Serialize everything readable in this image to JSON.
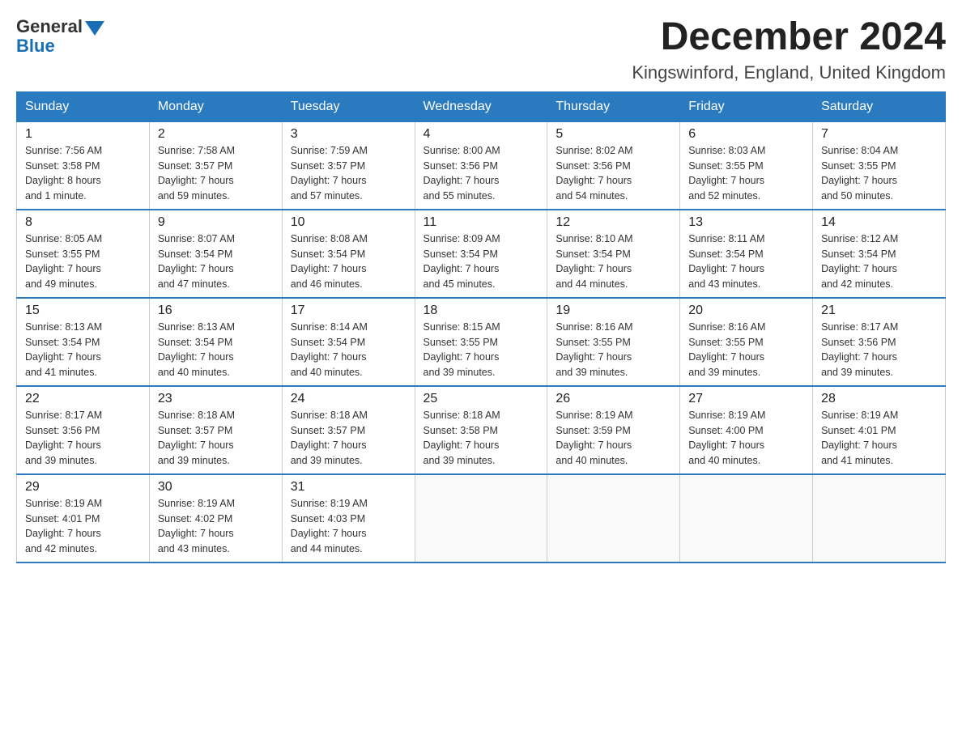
{
  "header": {
    "logo_general": "General",
    "logo_blue": "Blue",
    "month_title": "December 2024",
    "location": "Kingswinford, England, United Kingdom"
  },
  "days_of_week": [
    "Sunday",
    "Monday",
    "Tuesday",
    "Wednesday",
    "Thursday",
    "Friday",
    "Saturday"
  ],
  "weeks": [
    [
      {
        "day": "1",
        "sunrise": "7:56 AM",
        "sunset": "3:58 PM",
        "daylight": "8 hours and 1 minute."
      },
      {
        "day": "2",
        "sunrise": "7:58 AM",
        "sunset": "3:57 PM",
        "daylight": "7 hours and 59 minutes."
      },
      {
        "day": "3",
        "sunrise": "7:59 AM",
        "sunset": "3:57 PM",
        "daylight": "7 hours and 57 minutes."
      },
      {
        "day": "4",
        "sunrise": "8:00 AM",
        "sunset": "3:56 PM",
        "daylight": "7 hours and 55 minutes."
      },
      {
        "day": "5",
        "sunrise": "8:02 AM",
        "sunset": "3:56 PM",
        "daylight": "7 hours and 54 minutes."
      },
      {
        "day": "6",
        "sunrise": "8:03 AM",
        "sunset": "3:55 PM",
        "daylight": "7 hours and 52 minutes."
      },
      {
        "day": "7",
        "sunrise": "8:04 AM",
        "sunset": "3:55 PM",
        "daylight": "7 hours and 50 minutes."
      }
    ],
    [
      {
        "day": "8",
        "sunrise": "8:05 AM",
        "sunset": "3:55 PM",
        "daylight": "7 hours and 49 minutes."
      },
      {
        "day": "9",
        "sunrise": "8:07 AM",
        "sunset": "3:54 PM",
        "daylight": "7 hours and 47 minutes."
      },
      {
        "day": "10",
        "sunrise": "8:08 AM",
        "sunset": "3:54 PM",
        "daylight": "7 hours and 46 minutes."
      },
      {
        "day": "11",
        "sunrise": "8:09 AM",
        "sunset": "3:54 PM",
        "daylight": "7 hours and 45 minutes."
      },
      {
        "day": "12",
        "sunrise": "8:10 AM",
        "sunset": "3:54 PM",
        "daylight": "7 hours and 44 minutes."
      },
      {
        "day": "13",
        "sunrise": "8:11 AM",
        "sunset": "3:54 PM",
        "daylight": "7 hours and 43 minutes."
      },
      {
        "day": "14",
        "sunrise": "8:12 AM",
        "sunset": "3:54 PM",
        "daylight": "7 hours and 42 minutes."
      }
    ],
    [
      {
        "day": "15",
        "sunrise": "8:13 AM",
        "sunset": "3:54 PM",
        "daylight": "7 hours and 41 minutes."
      },
      {
        "day": "16",
        "sunrise": "8:13 AM",
        "sunset": "3:54 PM",
        "daylight": "7 hours and 40 minutes."
      },
      {
        "day": "17",
        "sunrise": "8:14 AM",
        "sunset": "3:54 PM",
        "daylight": "7 hours and 40 minutes."
      },
      {
        "day": "18",
        "sunrise": "8:15 AM",
        "sunset": "3:55 PM",
        "daylight": "7 hours and 39 minutes."
      },
      {
        "day": "19",
        "sunrise": "8:16 AM",
        "sunset": "3:55 PM",
        "daylight": "7 hours and 39 minutes."
      },
      {
        "day": "20",
        "sunrise": "8:16 AM",
        "sunset": "3:55 PM",
        "daylight": "7 hours and 39 minutes."
      },
      {
        "day": "21",
        "sunrise": "8:17 AM",
        "sunset": "3:56 PM",
        "daylight": "7 hours and 39 minutes."
      }
    ],
    [
      {
        "day": "22",
        "sunrise": "8:17 AM",
        "sunset": "3:56 PM",
        "daylight": "7 hours and 39 minutes."
      },
      {
        "day": "23",
        "sunrise": "8:18 AM",
        "sunset": "3:57 PM",
        "daylight": "7 hours and 39 minutes."
      },
      {
        "day": "24",
        "sunrise": "8:18 AM",
        "sunset": "3:57 PM",
        "daylight": "7 hours and 39 minutes."
      },
      {
        "day": "25",
        "sunrise": "8:18 AM",
        "sunset": "3:58 PM",
        "daylight": "7 hours and 39 minutes."
      },
      {
        "day": "26",
        "sunrise": "8:19 AM",
        "sunset": "3:59 PM",
        "daylight": "7 hours and 40 minutes."
      },
      {
        "day": "27",
        "sunrise": "8:19 AM",
        "sunset": "4:00 PM",
        "daylight": "7 hours and 40 minutes."
      },
      {
        "day": "28",
        "sunrise": "8:19 AM",
        "sunset": "4:01 PM",
        "daylight": "7 hours and 41 minutes."
      }
    ],
    [
      {
        "day": "29",
        "sunrise": "8:19 AM",
        "sunset": "4:01 PM",
        "daylight": "7 hours and 42 minutes."
      },
      {
        "day": "30",
        "sunrise": "8:19 AM",
        "sunset": "4:02 PM",
        "daylight": "7 hours and 43 minutes."
      },
      {
        "day": "31",
        "sunrise": "8:19 AM",
        "sunset": "4:03 PM",
        "daylight": "7 hours and 44 minutes."
      },
      null,
      null,
      null,
      null
    ]
  ]
}
